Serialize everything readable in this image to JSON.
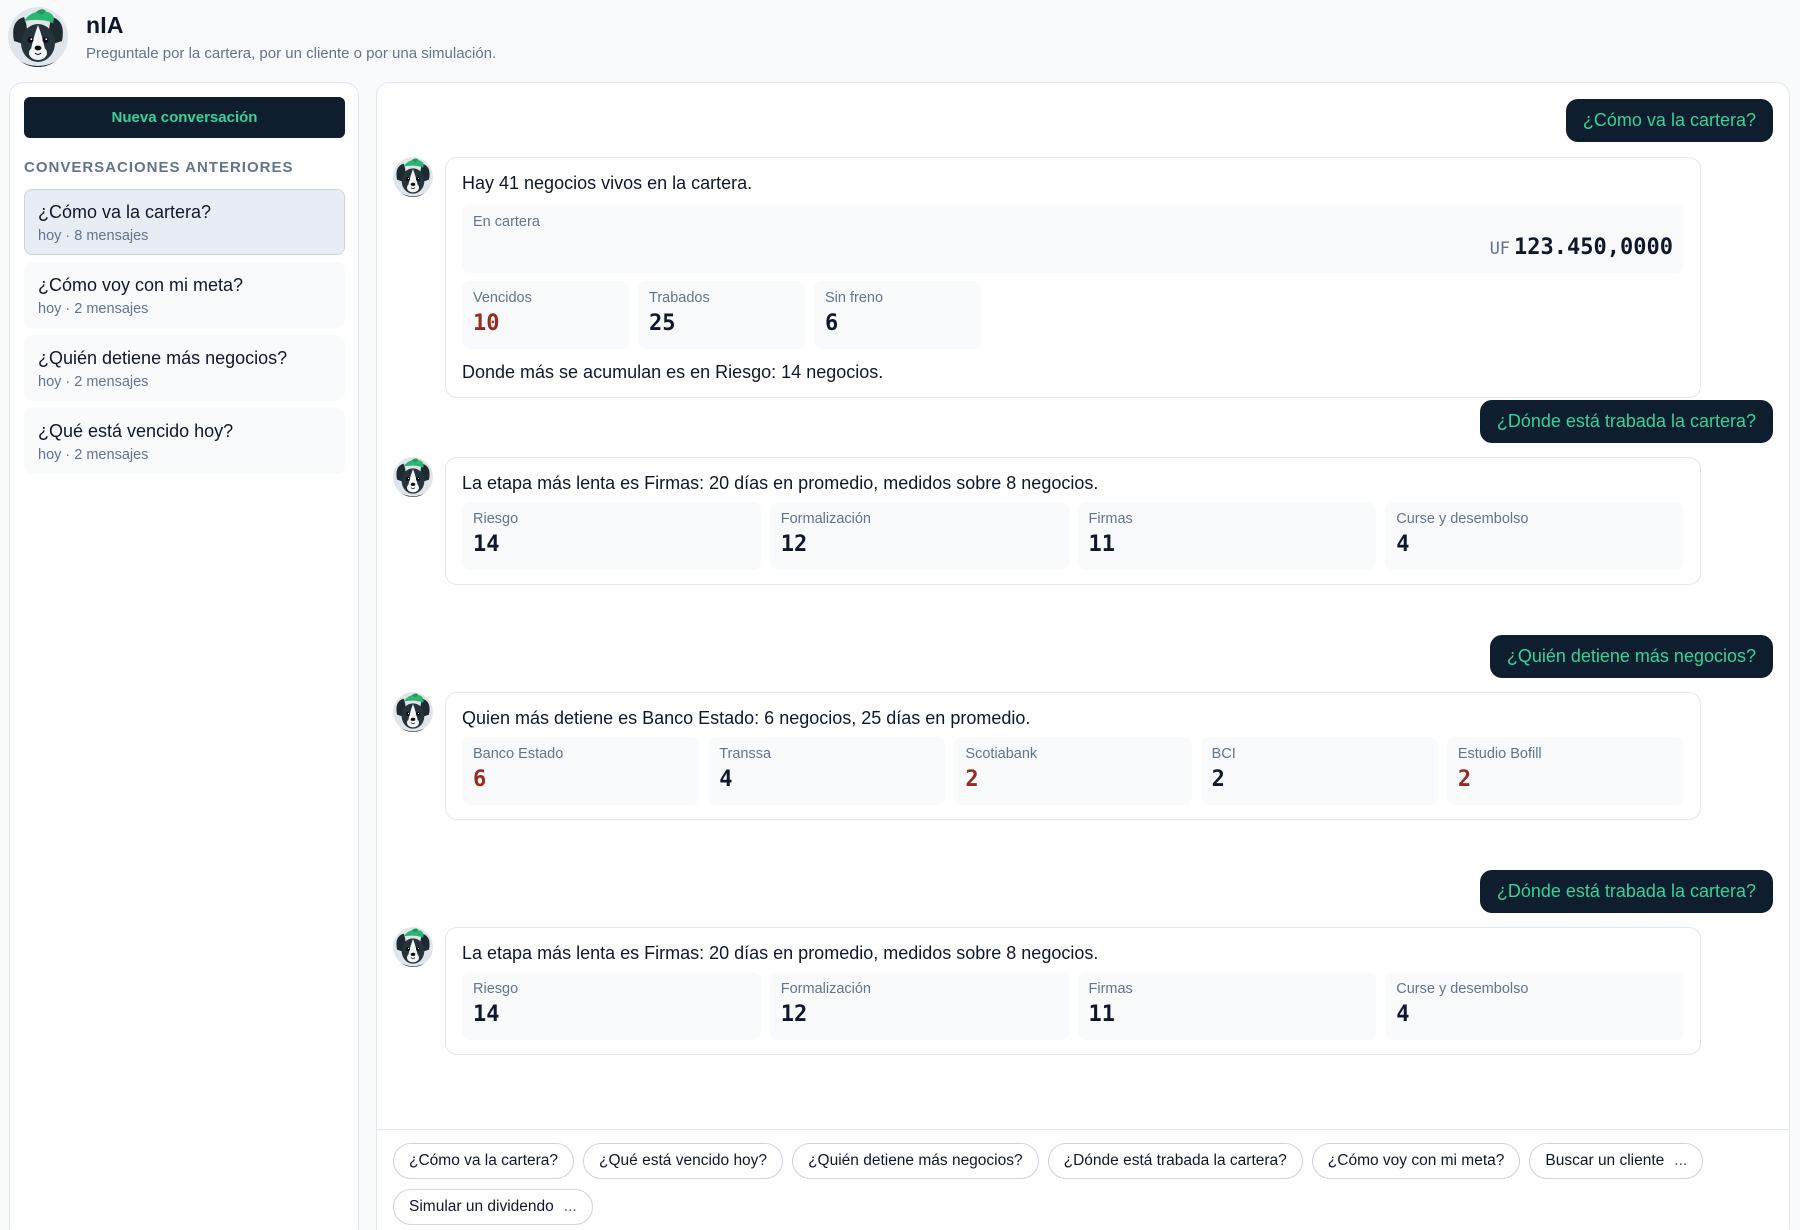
{
  "app": {
    "title": "nIA",
    "subtitle": "Preguntale por la cartera, por un cliente o por una simulación."
  },
  "colors": {
    "accent": "#34d399",
    "dark": "#0f1e2e",
    "alert": "#9a2a1f",
    "muted": "#64748b"
  },
  "sidebar": {
    "new_button": "Nueva conversación",
    "section_label": "CONVERSACIONES ANTERIORES",
    "items": [
      {
        "title": "¿Cómo va la cartera?",
        "meta": "hoy · 8 mensajes",
        "active": true
      },
      {
        "title": "¿Cómo voy con mi meta?",
        "meta": "hoy · 2 mensajes"
      },
      {
        "title": "¿Quién detiene más negocios?",
        "meta": "hoy · 2 mensajes"
      },
      {
        "title": "¿Qué está vencido hoy?",
        "meta": "hoy · 2 mensajes"
      }
    ]
  },
  "chat": {
    "messages": [
      {
        "role": "user",
        "text": "¿Cómo va la cartera?"
      },
      {
        "role": "bot",
        "text": "Hay 41 negocios vivos en la cartera.",
        "money": {
          "label": "En cartera",
          "unit": "UF",
          "value": "123.450,0000"
        },
        "stats": [
          {
            "label": "Vencidos",
            "value": "10",
            "alert": true
          },
          {
            "label": "Trabados",
            "value": "25"
          },
          {
            "label": "Sin freno",
            "value": "6"
          }
        ],
        "after": "Donde más se acumulan es en Riesgo: 14 negocios."
      },
      {
        "role": "user",
        "text": "¿Dónde está trabada la cartera?"
      },
      {
        "role": "bot",
        "text": "La etapa más lenta es Firmas: 20 días en promedio, medidos sobre 8 negocios.",
        "stats": [
          {
            "label": "Riesgo",
            "value": "14"
          },
          {
            "label": "Formalización",
            "value": "12"
          },
          {
            "label": "Firmas",
            "value": "11"
          },
          {
            "label": "Curse y desembolso",
            "value": "4"
          }
        ]
      },
      {
        "role": "user",
        "text": "¿Quién detiene más negocios?"
      },
      {
        "role": "bot",
        "text": "Quien más detiene es Banco Estado: 6 negocios, 25 días en promedio.",
        "stats": [
          {
            "label": "Banco Estado",
            "value": "6",
            "alert": true
          },
          {
            "label": "Transsa",
            "value": "4"
          },
          {
            "label": "Scotiabank",
            "value": "2",
            "alert": true
          },
          {
            "label": "BCI",
            "value": "2"
          },
          {
            "label": "Estudio Bofill",
            "value": "2",
            "alert": true
          }
        ]
      },
      {
        "role": "user",
        "text": "¿Dónde está trabada la cartera?"
      },
      {
        "role": "bot",
        "text": "La etapa más lenta es Firmas: 20 días en promedio, medidos sobre 8 negocios.",
        "stats": [
          {
            "label": "Riesgo",
            "value": "14"
          },
          {
            "label": "Formalización",
            "value": "12"
          },
          {
            "label": "Firmas",
            "value": "11"
          },
          {
            "label": "Curse y desembolso",
            "value": "4"
          }
        ]
      }
    ]
  },
  "suggestions": {
    "chips": [
      {
        "label": "¿Cómo va la cartera?"
      },
      {
        "label": "¿Qué está vencido hoy?"
      },
      {
        "label": "¿Quién detiene más negocios?"
      },
      {
        "label": "¿Dónde está trabada la cartera?"
      },
      {
        "label": "¿Cómo voy con mi meta?"
      },
      {
        "label": "Buscar un cliente",
        "ellipsis": "..."
      },
      {
        "label": "Simular un dividendo",
        "ellipsis": "..."
      }
    ]
  }
}
